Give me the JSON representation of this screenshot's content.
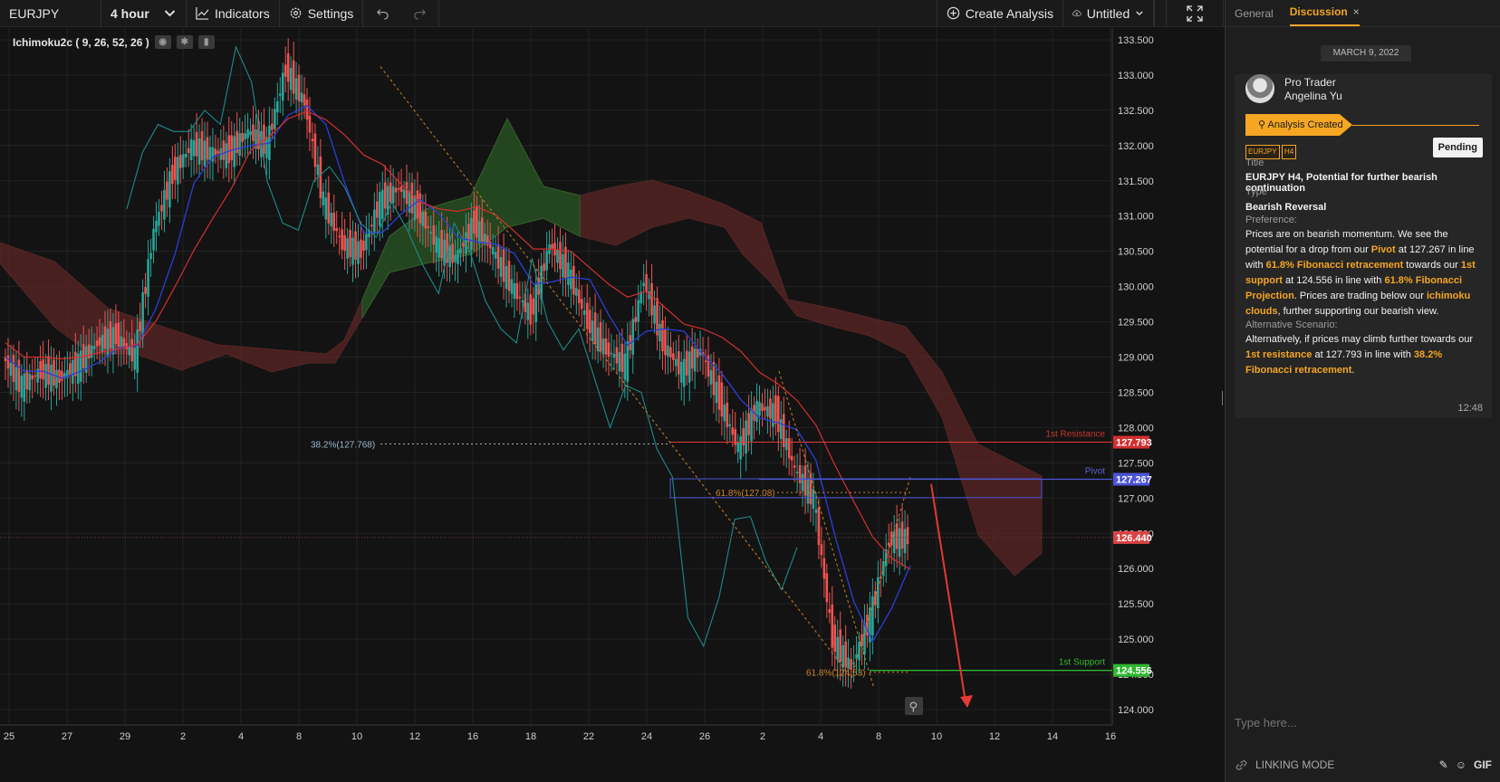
{
  "toolbar": {
    "symbol": "EURJPY",
    "interval": "4 hour",
    "indicators_label": "Indicators",
    "settings_label": "Settings",
    "create_analysis_label": "Create Analysis",
    "layout_name": "Untitled"
  },
  "chart": {
    "indicator_legend": "Ichimoku2c ( 9, 26, 52, 26 )",
    "y_ticks": [
      "133.500",
      "133.000",
      "132.500",
      "132.000",
      "131.500",
      "131.000",
      "130.500",
      "130.000",
      "129.500",
      "129.000",
      "128.500",
      "128.000",
      "127.500",
      "127.000",
      "126.500",
      "126.000",
      "125.500",
      "125.000",
      "124.500",
      "124.000"
    ],
    "x_ticks": [
      "25",
      "27",
      "29",
      "2",
      "4",
      "8",
      "10",
      "12",
      "16",
      "18",
      "22",
      "24",
      "26",
      "2",
      "4",
      "8",
      "10",
      "12",
      "14",
      "16"
    ],
    "levels": {
      "resistance": {
        "label": "1st Resistance",
        "value": "127.793",
        "color": "#e53935"
      },
      "pivot": {
        "label": "Pivot",
        "value": "127.267",
        "color": "#4c55d6"
      },
      "support": {
        "label": "1st Support",
        "value": "124.556",
        "color": "#2eb82e"
      },
      "current": {
        "value": "126.440",
        "color": "#e53935"
      }
    },
    "fib_labels": [
      "38.2%(127.768)",
      "61.8%(127.08)",
      "61.8%(124.53)"
    ]
  },
  "chart_data": {
    "type": "candlestick",
    "symbol": "EURJPY",
    "timeframe": "4 hour",
    "ylim": [
      123.9,
      133.55
    ],
    "close_points": [
      129.0,
      128.6,
      128.8,
      128.7,
      128.9,
      129.2,
      129.3,
      129.0,
      130.8,
      131.6,
      132.0,
      131.9,
      131.9,
      132.2,
      132.0,
      133.1,
      132.6,
      131.2,
      130.6,
      130.5,
      131.2,
      131.4,
      131.1,
      130.6,
      130.4,
      130.9,
      130.5,
      130.0,
      129.6,
      130.6,
      130.2,
      129.5,
      129.1,
      128.9,
      130.1,
      129.2,
      128.8,
      129.1,
      128.4,
      127.7,
      128.3,
      128.2,
      127.4,
      127.0,
      125.0,
      124.6,
      125.3,
      126.4,
      126.44
    ],
    "levels": [
      {
        "name": "1st Resistance",
        "value": 127.793
      },
      {
        "name": "Pivot",
        "value": 127.267
      },
      {
        "name": "1st Support",
        "value": 124.556
      },
      {
        "name": "Last",
        "value": 126.44
      }
    ]
  },
  "panel": {
    "tabs": [
      {
        "label": "General"
      },
      {
        "label": "Discussion"
      }
    ],
    "date_chip": "MARCH 9, 2022",
    "user_role": "Pro Trader",
    "user_name": "Angelina Yu",
    "banner": "Analysis Created",
    "tags": [
      "EURJPY",
      "H4"
    ],
    "status": "Pending",
    "title_label": "Title",
    "title_value": "EURJPY H4, Potential for further bearish continuation",
    "type_label": "Type",
    "type_value": "Bearish Reversal",
    "pref_label": "Preference:",
    "pref_parts": [
      "Prices are on bearish momentum. We see the potential for a drop from our ",
      "Pivot",
      " at 127.267 in line with ",
      "61.8% Fibonacci retracement",
      " towards our ",
      "1st support",
      " at 124.556 in line with ",
      "61.8% Fibonacci Projection",
      ". Prices are trading below our ",
      "ichimoku clouds",
      ", further supporting our bearish view."
    ],
    "alt_label": "Alternative Scenario:",
    "alt_parts": [
      "Alternatively, if prices may climb further towards our ",
      "1st resistance",
      " at 127.793 in line with ",
      "38.2% Fibonacci retracement",
      "."
    ],
    "time": "12:48",
    "input_placeholder": "Type here...",
    "linking_mode": "LINKING MODE",
    "gif_label": "GIF"
  }
}
